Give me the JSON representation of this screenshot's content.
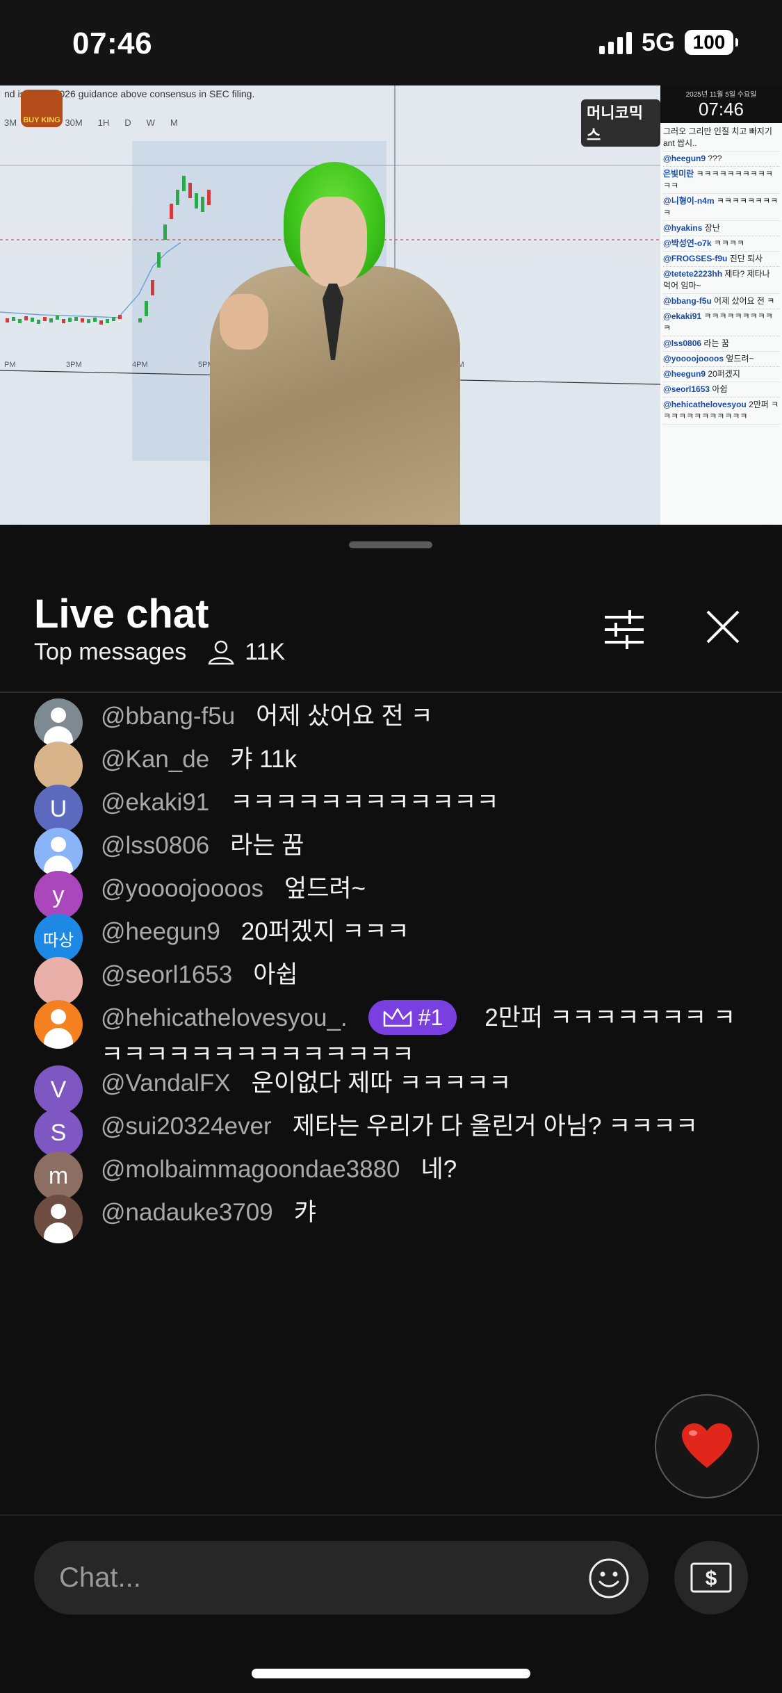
{
  "status_bar": {
    "time": "07:46",
    "network": "5G",
    "battery": "100"
  },
  "video": {
    "ticker_text": "nd issue ... 2026 guidance above consensus in SEC filing.",
    "timeframes": [
      "3M",
      "15M",
      "30M",
      "1H",
      "D",
      "W",
      "M"
    ],
    "x_labels": [
      "PM",
      "3PM",
      "4PM",
      "5PM",
      "9AM"
    ],
    "logo_text": "BUY KING",
    "brand_text": "머니코믹스",
    "overlay_date": "2025년 11월 5일 수요일",
    "overlay_time": "07:46",
    "overlay_lines": [
      {
        "user": "",
        "text": "그러오 그리만 인질 치고 빠지기 ant 쌉시.."
      },
      {
        "user": "@heegun9",
        "text": "???"
      },
      {
        "user": "은빛미란",
        "text": "ㅋㅋㅋㅋㅋㅋㅋㅋㅋㅋㅋㅋ"
      },
      {
        "user": "@니형이-n4m",
        "text": "ㅋㅋㅋㅋㅋㅋㅋㅋㅋ"
      },
      {
        "user": "@hyakins",
        "text": "장난"
      },
      {
        "user": "@박성연-o7k",
        "text": "ㅋㅋㅋㅋ"
      },
      {
        "user": "@FROGSES-f9u",
        "text": "진단 퇴사"
      },
      {
        "user": "@tetete2223hh",
        "text": "제타? 제타나 먹어 임마~"
      },
      {
        "user": "@bbang-f5u",
        "text": "어제 샀어요 전 ㅋ"
      },
      {
        "user": "@ekaki91",
        "text": "ㅋㅋㅋㅋㅋㅋㅋㅋㅋㅋ"
      },
      {
        "user": "@lss0806",
        "text": "라는 꿈"
      },
      {
        "user": "@yoooojoooos",
        "text": "엎드려~"
      },
      {
        "user": "@heegun9",
        "text": "20퍼겠지"
      },
      {
        "user": "@seorl1653",
        "text": "아쉽"
      },
      {
        "user": "@hehicathelovesyou",
        "text": "2만퍼 ㅋㅋㅋㅋㅋㅋㅋㅋㅋㅋㅋㅋ"
      }
    ]
  },
  "panel": {
    "title": "Live chat",
    "subtitle": "Top messages",
    "viewer_count": "11K"
  },
  "messages": [
    {
      "author": "@bbang-f5u",
      "text": "어제 샀어요 전 ㅋ",
      "avatar_type": "person",
      "avatar_color": "#7d8a92",
      "avatar_letter": ""
    },
    {
      "author": "@Kan_de",
      "text": "캬 11k",
      "avatar_type": "image",
      "avatar_color": "#d9b48a",
      "avatar_letter": ""
    },
    {
      "author": "@ekaki91",
      "text": "ㅋㅋㅋㅋㅋㅋㅋㅋㅋㅋㅋㅋ",
      "avatar_type": "letter",
      "avatar_color": "#5c6bc0",
      "avatar_letter": "U"
    },
    {
      "author": "@lss0806",
      "text": "라는 꿈",
      "avatar_type": "person-blue",
      "avatar_color": "#8ab4f8",
      "avatar_letter": ""
    },
    {
      "author": "@yoooojoooos",
      "text": "엎드려~",
      "avatar_type": "letter",
      "avatar_color": "#ab47bc",
      "avatar_letter": "y"
    },
    {
      "author": "@heegun9",
      "text": "20퍼겠지 ㅋㅋㅋ",
      "avatar_type": "letter",
      "avatar_color": "#1e88e5",
      "avatar_letter": "따상"
    },
    {
      "author": "@seorl1653",
      "text": "아쉽",
      "avatar_type": "image",
      "avatar_color": "#e8b0a8",
      "avatar_letter": ""
    },
    {
      "author": "@hehicathelovesyou_.",
      "badge": "#1",
      "text": "2만퍼 ㅋㅋㅋㅋㅋㅋㅋ ㅋㅋㅋㅋㅋㅋㅋㅋㅋㅋㅋㅋㅋㅋㅋ",
      "avatar_type": "person",
      "avatar_color": "#f4801f",
      "avatar_letter": ""
    },
    {
      "author": "@VandalFX",
      "text": "운이없다 제따 ㅋㅋㅋㅋㅋ",
      "avatar_type": "letter",
      "avatar_color": "#7e57c2",
      "avatar_letter": "V"
    },
    {
      "author": "@sui20324ever",
      "text": "제타는 우리가 다 올린거 아님? ㅋㅋㅋㅋ",
      "avatar_type": "letter",
      "avatar_color": "#7e57c2",
      "avatar_letter": "S"
    },
    {
      "author": "@molbaimmagoondae3880",
      "text": "네?",
      "avatar_type": "letter",
      "avatar_color": "#8d6e63",
      "avatar_letter": "m"
    },
    {
      "author": "@nadauke3709",
      "text": "캬",
      "avatar_type": "person",
      "avatar_color": "#6d4c41",
      "avatar_letter": ""
    }
  ],
  "input": {
    "placeholder": "Chat..."
  },
  "icons": {
    "filter": "sliders-icon",
    "close": "close-icon",
    "viewer": "person-icon",
    "heart": "heart-icon",
    "emoji": "smiley-icon",
    "super_chat": "dollar-icon"
  },
  "colors": {
    "background": "#0f0f0f",
    "badge": "#7a3fe0",
    "heart": "#e1261c"
  }
}
